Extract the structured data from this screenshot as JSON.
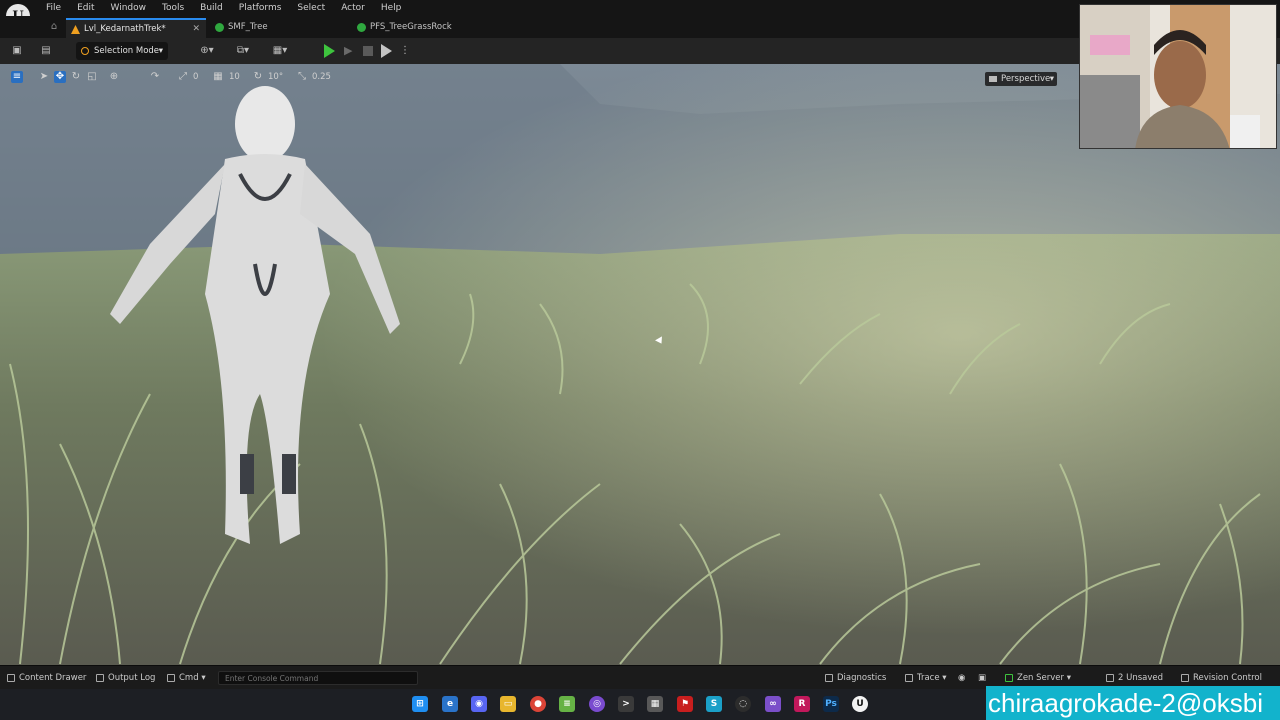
{
  "menu": {
    "items": [
      "File",
      "Edit",
      "Window",
      "Tools",
      "Build",
      "Platforms",
      "Select",
      "Actor",
      "Help"
    ]
  },
  "tabs": [
    {
      "label": "Lvl_KedarnathTrek*",
      "active": true,
      "icon_color": "#f0a020"
    },
    {
      "label": "SMF_Tree",
      "active": false,
      "icon_color": "#2fa83f"
    },
    {
      "label": "PFS_TreeGrassRock",
      "active": false,
      "icon_color": "#2fa83f"
    }
  ],
  "toolbar": {
    "mode_label": "Selection Mode"
  },
  "viewport_toolbar": {
    "rotation_snap": "0",
    "grid_snap": "10",
    "angle_snap": "10°",
    "scale_snap": "0.25",
    "view_mode": "Perspective"
  },
  "statusbar": {
    "content_drawer": "Content Drawer",
    "output_log": "Output Log",
    "cmd": "Cmd",
    "console_placeholder": "Enter Console Command",
    "diagnostics": "Diagnostics",
    "trace": "Trace",
    "zen_server": "Zen Server",
    "unsaved": "2 Unsaved",
    "revision_control": "Revision Control"
  },
  "overlay": {
    "username": "chiraagrokade-2@oksbi"
  },
  "colors": {
    "accent": "#2a8cf0",
    "play": "#3ec43e",
    "level_icon": "#f0a020",
    "username_bg": "#12b3cc"
  },
  "taskbar_icons": [
    "windows-icon",
    "edge-icon",
    "discord-icon",
    "file-explorer-icon",
    "chrome-icon",
    "notepad-icon",
    "github-icon",
    "terminal-icon",
    "calculator-icon",
    "flag-icon",
    "code-icon",
    "obs-icon",
    "visual-studio-icon",
    "rider-icon",
    "photoshop-icon",
    "unreal-icon"
  ]
}
